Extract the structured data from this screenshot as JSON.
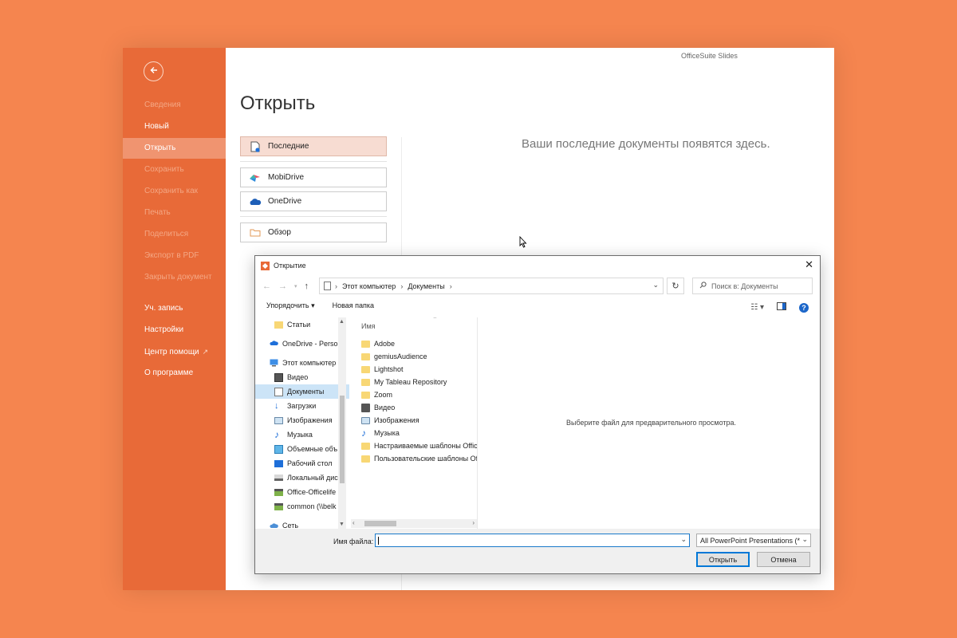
{
  "app": {
    "title": "OfficeSuite Slides"
  },
  "sidebar": {
    "items": [
      {
        "label": "Сведения",
        "state": "dim"
      },
      {
        "label": "Новый",
        "state": "normal"
      },
      {
        "label": "Открыть",
        "state": "selected"
      },
      {
        "label": "Сохранить",
        "state": "dim"
      },
      {
        "label": "Сохранить как",
        "state": "dim"
      },
      {
        "label": "Печать",
        "state": "dim"
      },
      {
        "label": "Поделиться",
        "state": "dim"
      },
      {
        "label": "Экспорт в PDF",
        "state": "dim"
      },
      {
        "label": "Закрыть документ",
        "state": "dim"
      },
      {
        "label": "Уч. запись",
        "state": "normal"
      },
      {
        "label": "Настройки",
        "state": "normal"
      },
      {
        "label": "Центр помощи",
        "state": "normal"
      },
      {
        "label": "О программе",
        "state": "normal"
      }
    ]
  },
  "main": {
    "title": "Открыть",
    "locations": [
      {
        "label": "Последние",
        "icon": "recent-doc-icon"
      },
      {
        "label": "MobiDrive",
        "icon": "mobidrive-icon"
      },
      {
        "label": "OneDrive",
        "icon": "onedrive-cloud-icon"
      },
      {
        "label": "Обзор",
        "icon": "folder-icon"
      }
    ],
    "empty_message": "Ваши последние документы появятся здесь."
  },
  "dialog": {
    "title": "Открытие",
    "breadcrumb": [
      "Этот компьютер",
      "Документы"
    ],
    "search_placeholder": "Поиск в: Документы",
    "toolbar": {
      "organize": "Упорядочить",
      "new_folder": "Новая папка"
    },
    "tree": [
      {
        "label": "Статьи",
        "icon": "folder-icon"
      },
      {
        "label": "OneDrive - Persor",
        "icon": "onedrive-cloud-icon"
      },
      {
        "label": "Этот компьютер",
        "icon": "computer-icon"
      },
      {
        "label": "Видео",
        "icon": "video-icon"
      },
      {
        "label": "Документы",
        "icon": "document-icon",
        "selected": true
      },
      {
        "label": "Загрузки",
        "icon": "download-icon"
      },
      {
        "label": "Изображения",
        "icon": "image-icon"
      },
      {
        "label": "Музыка",
        "icon": "music-icon"
      },
      {
        "label": "Объемные объ",
        "icon": "cube-icon"
      },
      {
        "label": "Рабочий стол",
        "icon": "desktop-icon"
      },
      {
        "label": "Локальный дис",
        "icon": "drive-icon"
      },
      {
        "label": "Office-Officelife",
        "icon": "network-drive-icon"
      },
      {
        "label": "common (\\\\belk",
        "icon": "network-drive-icon"
      },
      {
        "label": "Сеть",
        "icon": "network-icon"
      }
    ],
    "column_header": "Имя",
    "files": [
      {
        "name": "Adobe",
        "icon": "folder-icon"
      },
      {
        "name": "gemiusAudience",
        "icon": "folder-icon"
      },
      {
        "name": "Lightshot",
        "icon": "folder-icon"
      },
      {
        "name": "My Tableau Repository",
        "icon": "folder-icon"
      },
      {
        "name": "Zoom",
        "icon": "folder-icon"
      },
      {
        "name": "Видео",
        "icon": "video-icon"
      },
      {
        "name": "Изображения",
        "icon": "image-icon"
      },
      {
        "name": "Музыка",
        "icon": "music-icon"
      },
      {
        "name": "Настраиваемые шаблоны Office",
        "icon": "folder-icon"
      },
      {
        "name": "Пользовательские шаблоны Office",
        "icon": "folder-icon"
      }
    ],
    "preview_text": "Выберите файл для предварительного просмотра.",
    "filename_label": "Имя файла:",
    "filename_value": "",
    "filetype": "All PowerPoint Presentations (*",
    "open_button": "Открыть",
    "cancel_button": "Отмена"
  }
}
